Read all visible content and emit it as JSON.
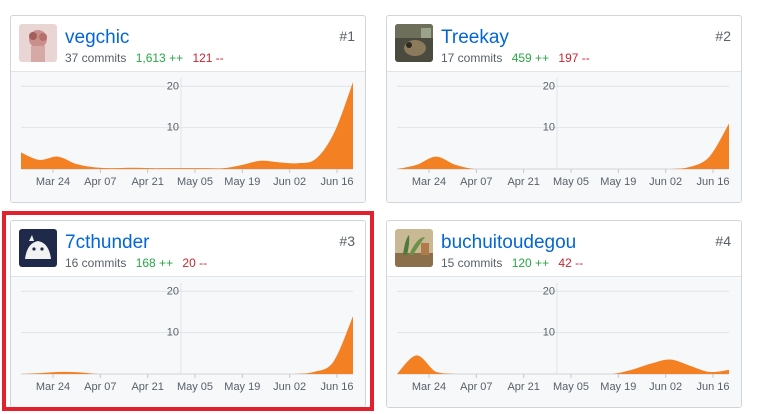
{
  "contributors": [
    {
      "rank": "#1",
      "username": "vegchic",
      "commits": "37 commits",
      "additions": "1,613 ++",
      "deletions": "121 --",
      "avatar_icon": "vegchic-avatar-icon",
      "chart_data": {
        "type": "area",
        "x_labels": [
          "Mar 24",
          "Apr 07",
          "Apr 21",
          "May 05",
          "May 19",
          "Jun 02",
          "Jun 16"
        ],
        "y_ticks": [
          10,
          20
        ],
        "ylim": [
          0,
          22
        ],
        "grid": true,
        "color": "#f48024",
        "values": [
          4,
          2.2,
          3,
          1.2,
          0.4,
          0.2,
          0.3,
          0.2,
          0.2,
          0.2,
          0.2,
          0.2,
          1,
          2,
          1.6,
          1.4,
          2.5,
          9,
          21
        ]
      }
    },
    {
      "rank": "#2",
      "username": "Treekay",
      "commits": "17 commits",
      "additions": "459 ++",
      "deletions": "197 --",
      "avatar_icon": "treekay-avatar-icon",
      "chart_data": {
        "type": "area",
        "x_labels": [
          "Mar 24",
          "Apr 07",
          "Apr 21",
          "May 05",
          "May 19",
          "Jun 02",
          "Jun 16"
        ],
        "y_ticks": [
          10,
          20
        ],
        "ylim": [
          0,
          22
        ],
        "grid": true,
        "color": "#f48024",
        "values": [
          0,
          1,
          3,
          1,
          0,
          0,
          0,
          0,
          0,
          0,
          0,
          0,
          0,
          0,
          0,
          0.5,
          3,
          11
        ]
      }
    },
    {
      "rank": "#3",
      "username": "7cthunder",
      "commits": "16 commits",
      "additions": "168 ++",
      "deletions": "20 --",
      "avatar_icon": "7cthunder-avatar-icon",
      "chart_data": {
        "type": "area",
        "x_labels": [
          "Mar 24",
          "Apr 07",
          "Apr 21",
          "May 05",
          "May 19",
          "Jun 02",
          "Jun 16"
        ],
        "y_ticks": [
          10,
          20
        ],
        "ylim": [
          0,
          22
        ],
        "grid": true,
        "color": "#f48024",
        "values": [
          0,
          0.2,
          0.5,
          0.4,
          0,
          0,
          0,
          0,
          0,
          0,
          0,
          0,
          0,
          0,
          0,
          0.5,
          3,
          14
        ]
      }
    },
    {
      "rank": "#4",
      "username": "buchuitoudegou",
      "commits": "15 commits",
      "additions": "120 ++",
      "deletions": "42 --",
      "avatar_icon": "buchuitoudegou-avatar-icon",
      "chart_data": {
        "type": "area",
        "x_labels": [
          "Mar 24",
          "Apr 07",
          "Apr 21",
          "May 05",
          "May 19",
          "Jun 02",
          "Jun 16"
        ],
        "y_ticks": [
          10,
          20
        ],
        "ylim": [
          0,
          22
        ],
        "grid": true,
        "color": "#f48024",
        "values": [
          0,
          4.5,
          0.5,
          0,
          0,
          0,
          0,
          0,
          0,
          0,
          0,
          0,
          1,
          2.5,
          3.5,
          2,
          0.5,
          1
        ]
      }
    }
  ],
  "colors": {
    "link": "#0366d6",
    "additions": "#28a745",
    "deletions": "#cb2431",
    "area": "#f48024",
    "highlight": "#e3202d"
  }
}
